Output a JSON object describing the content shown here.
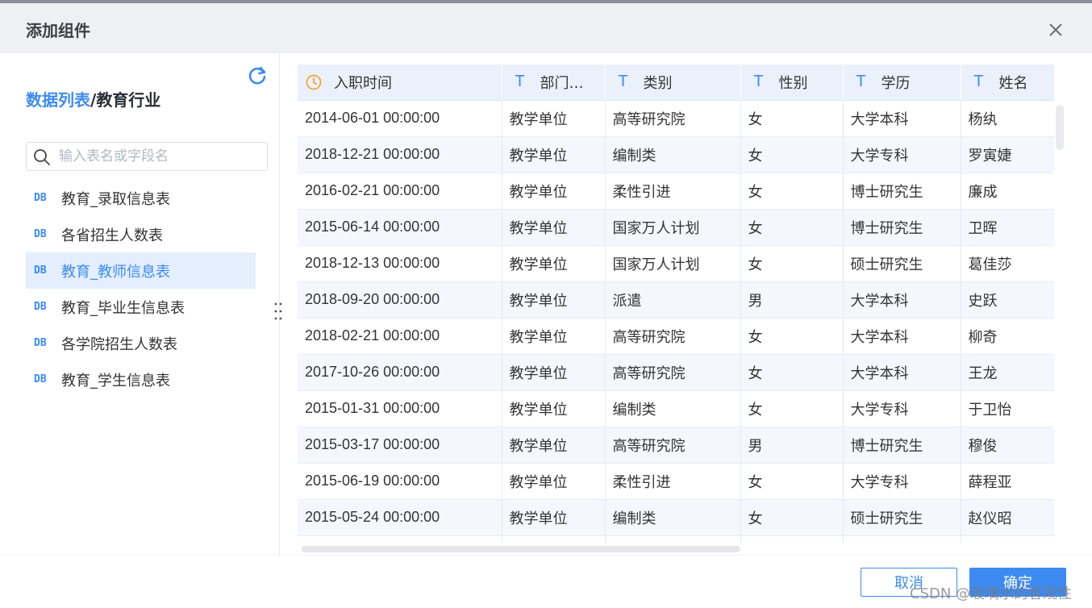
{
  "dialog": {
    "title": "添加组件",
    "close_icon": "close-icon"
  },
  "left": {
    "breadcrumb_link": "数据列表",
    "breadcrumb_sep": "/",
    "breadcrumb_current": "教育行业",
    "refresh_icon": "refresh-icon",
    "search": {
      "placeholder": "输入表名或字段名",
      "value": ""
    },
    "tables": [
      {
        "icon": "DB",
        "label": "教育_录取信息表"
      },
      {
        "icon": "DB",
        "label": "各省招生人数表"
      },
      {
        "icon": "DB",
        "label": "教育_教师信息表",
        "selected": true
      },
      {
        "icon": "DB",
        "label": "教育_毕业生信息表"
      },
      {
        "icon": "DB",
        "label": "各学院招生人数表"
      },
      {
        "icon": "DB",
        "label": "教育_学生信息表"
      }
    ]
  },
  "grid": {
    "columns": [
      {
        "type_icon": "clock-icon",
        "name": "入职时间"
      },
      {
        "type_icon": "T",
        "name": "部门…"
      },
      {
        "type_icon": "T",
        "name": "类别"
      },
      {
        "type_icon": "T",
        "name": "性别"
      },
      {
        "type_icon": "T",
        "name": "学历"
      },
      {
        "type_icon": "T",
        "name": "姓名"
      }
    ],
    "rows": [
      [
        "2014-06-01 00:00:00",
        "教学单位",
        "高等研究院",
        "女",
        "大学本科",
        "杨纨"
      ],
      [
        "2018-12-21 00:00:00",
        "教学单位",
        "编制类",
        "女",
        "大学专科",
        "罗寅婕"
      ],
      [
        "2016-02-21 00:00:00",
        "教学单位",
        "柔性引进",
        "女",
        "博士研究生",
        "廉成"
      ],
      [
        "2015-06-14 00:00:00",
        "教学单位",
        "国家万人计划",
        "女",
        "博士研究生",
        "卫晖"
      ],
      [
        "2018-12-13 00:00:00",
        "教学单位",
        "国家万人计划",
        "女",
        "硕士研究生",
        "葛佳莎"
      ],
      [
        "2018-09-20 00:00:00",
        "教学单位",
        "派遣",
        "男",
        "大学本科",
        "史跃"
      ],
      [
        "2018-02-21 00:00:00",
        "教学单位",
        "高等研究院",
        "女",
        "大学本科",
        "柳奇"
      ],
      [
        "2017-10-26 00:00:00",
        "教学单位",
        "高等研究院",
        "女",
        "大学本科",
        "王龙"
      ],
      [
        "2015-01-31 00:00:00",
        "教学单位",
        "编制类",
        "女",
        "大学专科",
        "于卫怡"
      ],
      [
        "2015-03-17 00:00:00",
        "教学单位",
        "高等研究院",
        "男",
        "博士研究生",
        "穆俊"
      ],
      [
        "2015-06-19 00:00:00",
        "教学单位",
        "柔性引进",
        "女",
        "大学专科",
        "薛程亚"
      ],
      [
        "2015-05-24 00:00:00",
        "教学单位",
        "编制类",
        "女",
        "硕士研究生",
        "赵仪昭"
      ],
      [
        "",
        "",
        "",
        "",
        "",
        ""
      ]
    ]
  },
  "footer": {
    "cancel_label": "取消",
    "ok_label": "确定",
    "watermark": "CSDN @玻璃水的客观性"
  },
  "colors": {
    "accent": "#3d8bf2",
    "header_bg": "#eef0f3",
    "grid_header_bg": "#eaf1fb",
    "selected_bg": "#e4eefc"
  }
}
